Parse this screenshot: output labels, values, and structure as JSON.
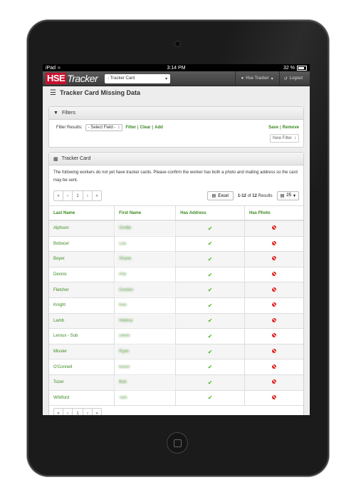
{
  "statusbar": {
    "device": "iPad",
    "time": "3:14 PM",
    "battery": "32 %"
  },
  "navbar": {
    "logo_hse": "HSE",
    "logo_tracker": "Tracker",
    "page_select": "- Tracker Card",
    "user": "Hse Tracker",
    "logout": "Logout"
  },
  "page": {
    "title": "Tracker Card Missing Data"
  },
  "filters": {
    "heading": "Filters",
    "label": "Filter Results:",
    "field_select": "- Select Field -",
    "filter_link": "Filter",
    "clear_link": "Clear",
    "add_link": "Add",
    "save_link": "Save",
    "remove_link": "Remove",
    "new_filter": "New Filter"
  },
  "tracker": {
    "heading": "Tracker Card",
    "description": "The following workers do not yet have tracker cards. Please confirm the worker has both a photo and mailing address so the card may be sent.",
    "pager": {
      "first": "«",
      "prev": "‹",
      "page": "1",
      "next": "›",
      "last": "»"
    },
    "excel": "Excel",
    "results_range": "1-12",
    "results_of": "of",
    "results_total": "12",
    "results_label": "Results",
    "per_page": "25",
    "columns": [
      "Last Name",
      "First Name",
      "Has Address",
      "Has Photo"
    ],
    "rows": [
      {
        "last": "Alphson",
        "first": "Orville"
      },
      {
        "last": "Bobocel",
        "first": "Lou"
      },
      {
        "last": "Boyer",
        "first": "Shane"
      },
      {
        "last": "Dennis",
        "first": "Phil"
      },
      {
        "last": "Fletcher",
        "first": "Gordon"
      },
      {
        "last": "Knight",
        "first": "Ken"
      },
      {
        "last": "Lamb",
        "first": "Helena"
      },
      {
        "last": "Leroux - Sub",
        "first": "Denis"
      },
      {
        "last": "Missler",
        "first": "Ryan"
      },
      {
        "last": "O'Connell",
        "first": "Kevin"
      },
      {
        "last": "Tozer",
        "first": "Bob"
      },
      {
        "last": "Whitford",
        "first": "Tom"
      }
    ]
  }
}
